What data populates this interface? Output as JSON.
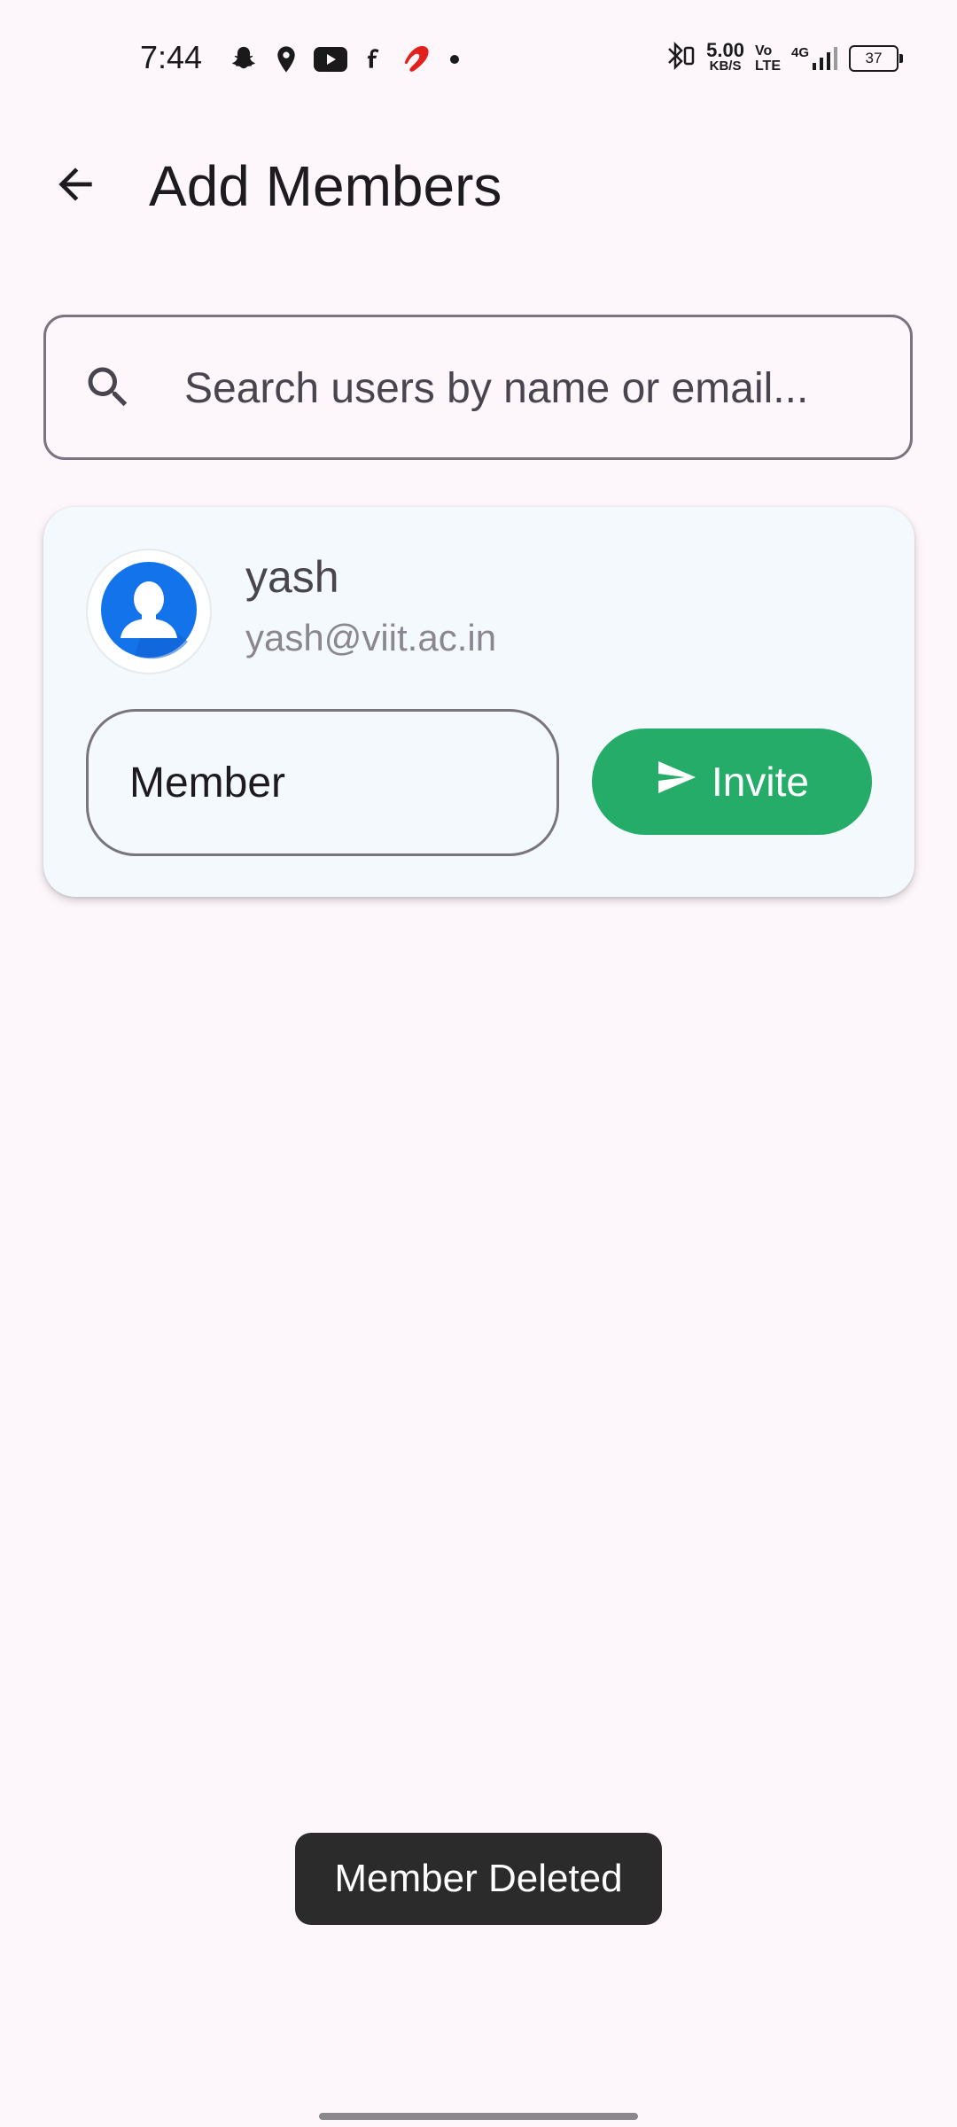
{
  "status_bar": {
    "time": "7:44",
    "left_icons": [
      "snapchat-icon",
      "location-pin-icon",
      "youtube-icon",
      "flipkart-icon",
      "airtel-icon",
      "dot-icon"
    ],
    "net_speed_value": "5.00",
    "net_speed_unit": "KB/S",
    "volte_top": "Vo",
    "volte_bottom": "LTE",
    "network_type": "4G",
    "battery_level": "37"
  },
  "app_bar": {
    "title": "Add Members",
    "back_icon": "arrow-back-icon"
  },
  "search": {
    "placeholder": "Search users by name or email...",
    "value": "",
    "icon": "search-icon"
  },
  "user_card": {
    "name": "yash",
    "email": "yash@viit.ac.in",
    "role": "Member",
    "invite_label": "Invite",
    "invite_icon": "send-icon",
    "accent_color": "#24ac68"
  },
  "snackbar": {
    "message": "Member Deleted"
  }
}
